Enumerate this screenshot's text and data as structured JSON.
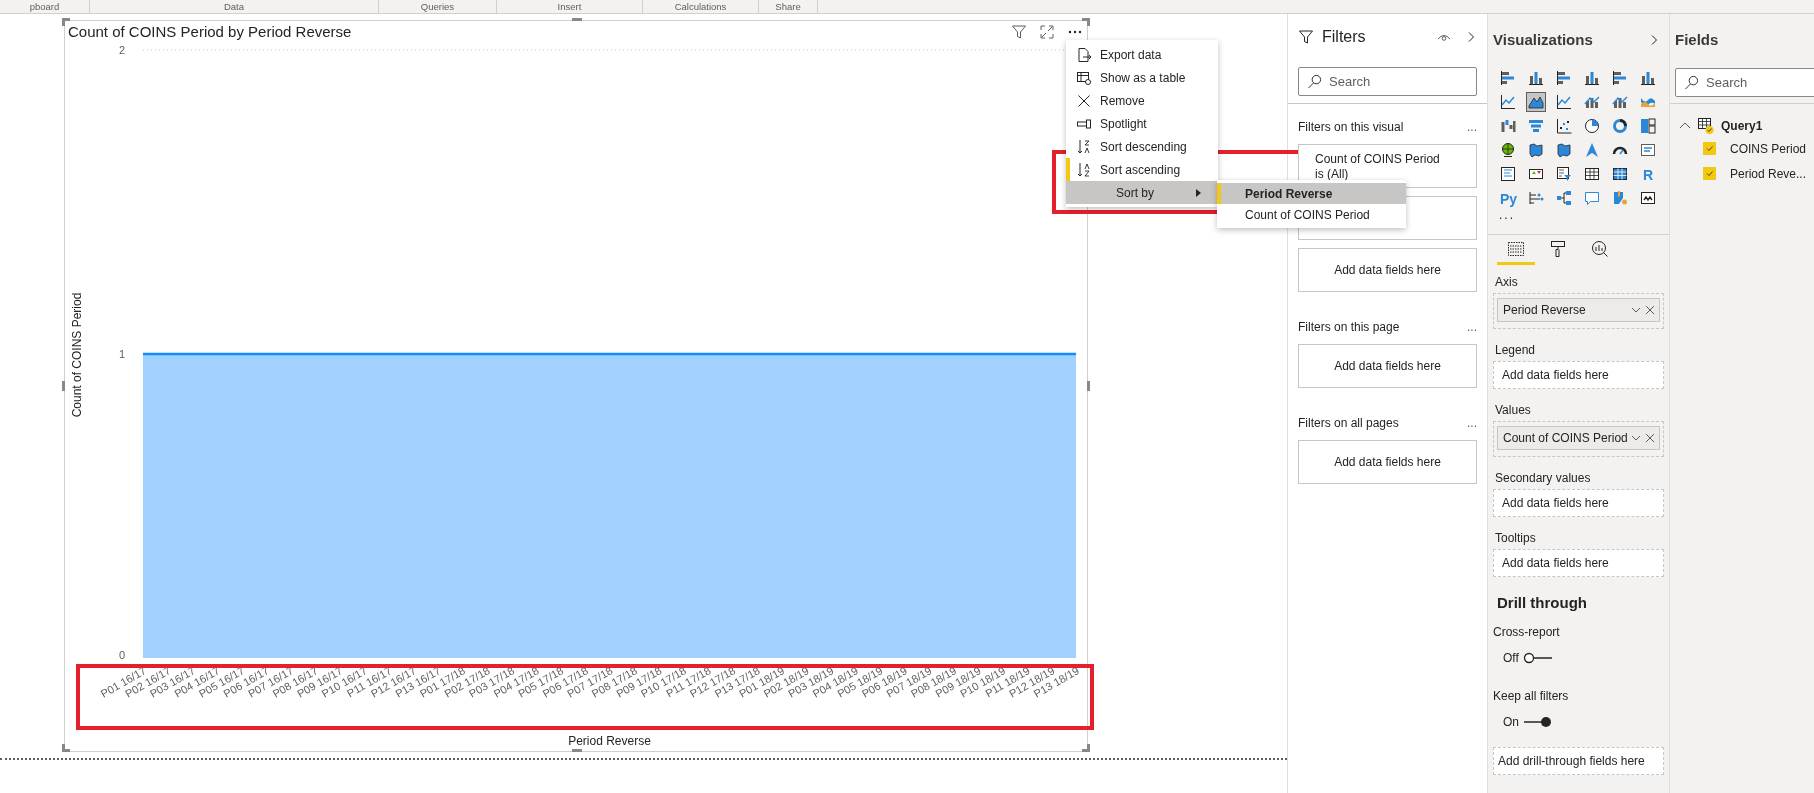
{
  "ribbon": {
    "groups": [
      "pboard",
      "Data",
      "Queries",
      "Insert",
      "Calculations",
      "Share"
    ]
  },
  "visual": {
    "chart_data": {
      "type": "area",
      "title": "Count of COINS Period by Period Reverse",
      "xlabel": "Period Reverse",
      "ylabel": "Count of COINS Period",
      "categories": [
        "P01 16/17",
        "P02 16/17",
        "P03 16/17",
        "P04 16/17",
        "P05 16/17",
        "P06 16/17",
        "P07 16/17",
        "P08 16/17",
        "P09 16/17",
        "P10 16/17",
        "P11 16/17",
        "P12 16/17",
        "P13 16/17",
        "P01 17/18",
        "P02 17/18",
        "P03 17/18",
        "P04 17/18",
        "P05 17/18",
        "P06 17/18",
        "P07 17/18",
        "P08 17/18",
        "P09 17/18",
        "P10 17/18",
        "P11 17/18",
        "P12 17/18",
        "P13 17/18",
        "P01 18/19",
        "P02 18/19",
        "P03 18/19",
        "P04 18/19",
        "P05 18/19",
        "P06 18/19",
        "P07 18/19",
        "P08 18/19",
        "P09 18/19",
        "P10 18/19",
        "P11 18/19",
        "P12 18/19",
        "P13 18/19"
      ],
      "series": [
        {
          "color": "#118dff",
          "values": [
            1,
            1,
            1,
            1,
            1,
            1,
            1,
            1,
            1,
            1,
            1,
            1,
            1,
            1,
            1,
            1,
            1,
            1,
            1,
            1,
            1,
            1,
            1,
            1,
            1,
            1,
            1,
            1,
            1,
            1,
            1,
            1,
            1,
            1,
            1,
            1,
            1,
            1,
            1
          ]
        }
      ],
      "ylim": [
        0,
        2
      ],
      "yticks": [
        0,
        1,
        2
      ]
    }
  },
  "context_menu": {
    "items": [
      {
        "label": "Export data",
        "kind": "action",
        "selected": false
      },
      {
        "label": "Show as a table",
        "kind": "action",
        "selected": false
      },
      {
        "label": "Remove",
        "kind": "action",
        "selected": false
      },
      {
        "label": "Spotlight",
        "kind": "action",
        "selected": false
      },
      {
        "label": "Sort descending",
        "kind": "action",
        "selected": false
      },
      {
        "label": "Sort ascending",
        "kind": "action",
        "selected": true
      },
      {
        "label": "Sort by",
        "kind": "submenu",
        "selected": false,
        "expanded": true
      }
    ]
  },
  "submenu": {
    "items": [
      {
        "label": "Period Reverse",
        "selected": true
      },
      {
        "label": "Count of COINS Period",
        "selected": false
      }
    ]
  },
  "filters_pane": {
    "title": "Filters",
    "search": {
      "placeholder": "Search"
    },
    "sections": [
      {
        "title": "Filters on this visual",
        "more": "...",
        "cards": [
          {
            "kind": "filter",
            "title": "Count of COINS Period",
            "value": "is (All)"
          },
          {
            "kind": "filter"
          }
        ],
        "placeholder": "Add data fields here"
      },
      {
        "title": "Filters on this page",
        "more": "...",
        "placeholder": "Add data fields here"
      },
      {
        "title": "Filters on all pages",
        "more": "...",
        "placeholder": "Add data fields here"
      }
    ]
  },
  "visualizations_pane": {
    "title": "Visualizations",
    "types": [
      {
        "kind": "hbar",
        "selected": false
      },
      {
        "kind": "vbar",
        "selected": false
      },
      {
        "kind": "hbar",
        "selected": false
      },
      {
        "kind": "vbar",
        "selected": false
      },
      {
        "kind": "hbar",
        "selected": false
      },
      {
        "kind": "vbar",
        "selected": false
      },
      {
        "kind": "line",
        "selected": false
      },
      {
        "kind": "area",
        "selected": true
      },
      {
        "kind": "line",
        "selected": false
      },
      {
        "kind": "combo",
        "selected": false
      },
      {
        "kind": "combo",
        "selected": false
      },
      {
        "kind": "ribbon",
        "selected": false
      },
      {
        "kind": "waterfall",
        "selected": false
      },
      {
        "kind": "funnel",
        "selected": false
      },
      {
        "kind": "scatter",
        "selected": false
      },
      {
        "kind": "pie",
        "selected": false
      },
      {
        "kind": "donut",
        "selected": false
      },
      {
        "kind": "treemap",
        "selected": false
      },
      {
        "kind": "globe",
        "selected": false
      },
      {
        "kind": "map",
        "selected": false
      },
      {
        "kind": "map",
        "selected": false
      },
      {
        "kind": "arrow",
        "selected": false
      },
      {
        "kind": "gauge",
        "selected": false
      },
      {
        "kind": "card",
        "selected": false
      },
      {
        "kind": "multirow",
        "selected": false
      },
      {
        "kind": "kpi",
        "selected": false
      },
      {
        "kind": "slicer",
        "selected": false
      },
      {
        "kind": "table",
        "selected": false
      },
      {
        "kind": "matrix",
        "selected": false
      },
      {
        "kind": "letter",
        "label": "R",
        "selected": false
      },
      {
        "kind": "letter",
        "label": "Py",
        "selected": false
      },
      {
        "kind": "influencers",
        "selected": false
      },
      {
        "kind": "decomp",
        "selected": false
      },
      {
        "kind": "bubble",
        "selected": false
      },
      {
        "kind": "custom",
        "selected": false
      },
      {
        "kind": "powerapps",
        "selected": false
      }
    ],
    "more": "...",
    "tabs": [
      {
        "kind": "fields",
        "selected": true
      },
      {
        "kind": "format",
        "selected": false
      },
      {
        "kind": "analytics",
        "selected": false
      }
    ],
    "wells": [
      {
        "label": "Axis",
        "chips": [
          {
            "label": "Period Reverse"
          }
        ]
      },
      {
        "label": "Legend",
        "placeholder": "Add data fields here"
      },
      {
        "label": "Values",
        "chips": [
          {
            "label": "Count of COINS Period"
          }
        ]
      },
      {
        "label": "Secondary values",
        "placeholder": "Add data fields here"
      },
      {
        "label": "Tooltips",
        "placeholder": "Add data fields here"
      }
    ],
    "drill_through": {
      "title": "Drill through",
      "toggles": [
        {
          "label": "Cross-report",
          "state_label": "Off",
          "on": false
        },
        {
          "label": "Keep all filters",
          "state_label": "On",
          "on": true
        }
      ],
      "placeholder": "Add drill-through fields here"
    }
  },
  "fields_pane": {
    "title": "Fields",
    "search": {
      "placeholder": "Search"
    },
    "tables": [
      {
        "name": "Query1",
        "expanded": true,
        "children": [
          {
            "name": "COINS Period",
            "checked": true
          },
          {
            "name": "Period Reve...",
            "checked": true
          }
        ]
      }
    ]
  }
}
